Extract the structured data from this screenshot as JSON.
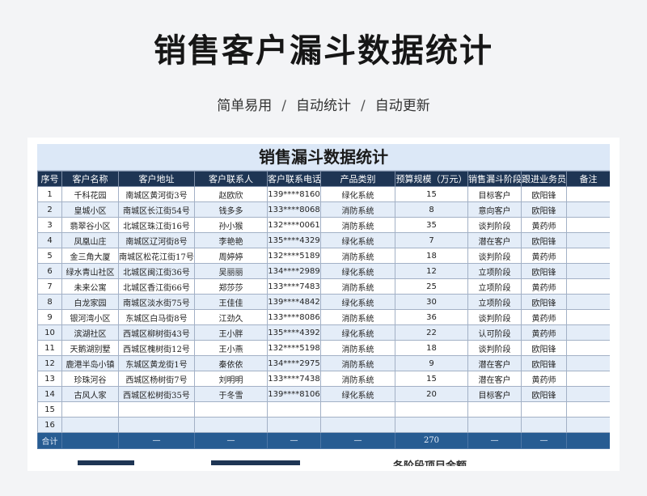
{
  "header": {
    "title": "销售客户漏斗数据统计",
    "subtitle_parts": [
      "简单易用",
      "自动统计",
      "自动更新"
    ],
    "separator": "/"
  },
  "sheet": {
    "title": "销售漏斗数据统计",
    "columns": [
      "序号",
      "客户名称",
      "客户地址",
      "客户联系人",
      "客户联系电话",
      "产品类别",
      "预算规模（万元）",
      "销售漏斗阶段",
      "跟进业务员",
      "备注"
    ],
    "rows": [
      [
        "1",
        "千科花园",
        "南城区黄河街3号",
        "赵欧欣",
        "139****8160",
        "绿化系统",
        "15",
        "目标客户",
        "欧阳锋",
        ""
      ],
      [
        "2",
        "皇城小区",
        "南城区长江街54号",
        "钱多多",
        "133****8068",
        "消防系统",
        "8",
        "意向客户",
        "欧阳锋",
        ""
      ],
      [
        "3",
        "翡翠谷小区",
        "北城区珠江街16号",
        "孙小猴",
        "132****0061",
        "消防系统",
        "35",
        "谈判阶段",
        "黄药师",
        ""
      ],
      [
        "4",
        "凤凰山庄",
        "南城区辽河街8号",
        "李艳艳",
        "135****4329",
        "绿化系统",
        "7",
        "潜在客户",
        "欧阳锋",
        ""
      ],
      [
        "5",
        "金三角大厦",
        "南城区松花江街17号",
        "周婷婷",
        "132****5189",
        "消防系统",
        "18",
        "谈判阶段",
        "黄药师",
        ""
      ],
      [
        "6",
        "绿水青山社区",
        "北城区闽江街36号",
        "吴丽丽",
        "134****2989",
        "绿化系统",
        "12",
        "立项阶段",
        "欧阳锋",
        ""
      ],
      [
        "7",
        "未来公寓",
        "北城区香江街66号",
        "郑莎莎",
        "133****7483",
        "消防系统",
        "25",
        "立项阶段",
        "黄药师",
        ""
      ],
      [
        "8",
        "白龙家园",
        "南城区淡水街75号",
        "王佳佳",
        "139****4842",
        "绿化系统",
        "30",
        "立项阶段",
        "欧阳锋",
        ""
      ],
      [
        "9",
        "银河湾小区",
        "东城区白马街8号",
        "江劲久",
        "133****8086",
        "消防系统",
        "36",
        "谈判阶段",
        "黄药师",
        ""
      ],
      [
        "10",
        "滨湖社区",
        "西城区柳树街43号",
        "王小胖",
        "135****4392",
        "绿化系统",
        "22",
        "认可阶段",
        "黄药师",
        ""
      ],
      [
        "11",
        "天鹅湖别墅",
        "西城区槐树街12号",
        "王小燕",
        "132****5198",
        "消防系统",
        "18",
        "谈判阶段",
        "欧阳锋",
        ""
      ],
      [
        "12",
        "鹿港半岛小镇",
        "东城区黄龙街1号",
        "秦依依",
        "134****2975",
        "消防系统",
        "9",
        "潜在客户",
        "欧阳锋",
        ""
      ],
      [
        "13",
        "珍珠河谷",
        "西城区杨树街7号",
        "刘明明",
        "133****7438",
        "消防系统",
        "15",
        "潜在客户",
        "黄药师",
        ""
      ],
      [
        "14",
        "古风人家",
        "西城区松树街35号",
        "于冬雪",
        "139****8106",
        "绿化系统",
        "20",
        "目标客户",
        "欧阳锋",
        ""
      ],
      [
        "15",
        "",
        "",
        "",
        "",
        "",
        "",
        "",
        "",
        ""
      ],
      [
        "16",
        "",
        "",
        "",
        "",
        "",
        "",
        "",
        "",
        ""
      ]
    ],
    "total_row": [
      "合计",
      "",
      "—",
      "—",
      "—",
      "—",
      "270",
      "—",
      "—",
      ""
    ],
    "next_section_title": "各阶段项目金额"
  }
}
